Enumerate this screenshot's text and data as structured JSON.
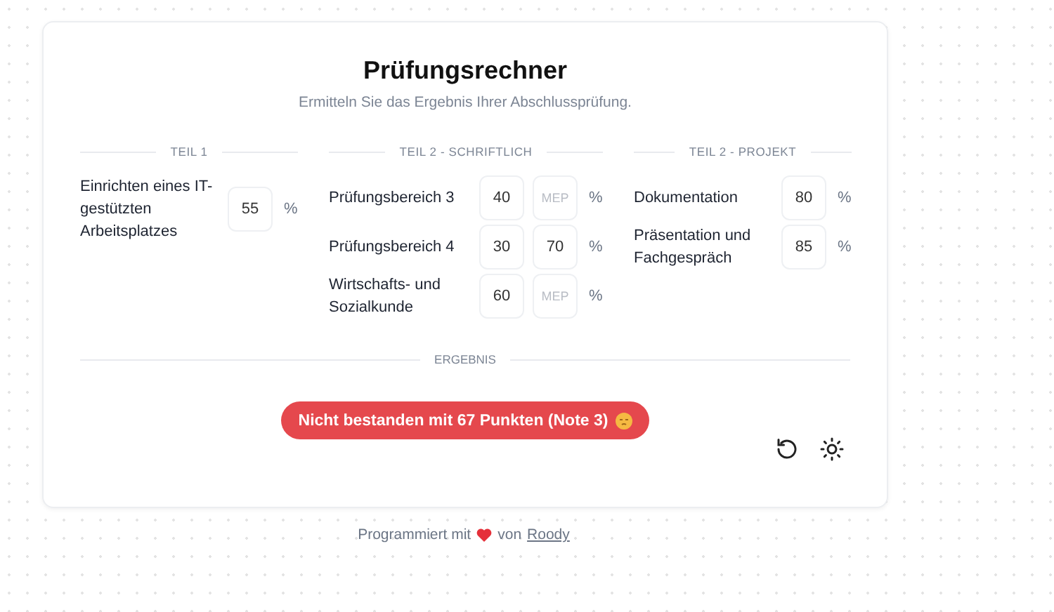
{
  "title": "Prüfungsrechner",
  "subtitle": "Ermitteln Sie das Ergebnis Ihrer Abschlussprüfung.",
  "sections": [
    {
      "heading": "TEIL 1",
      "fields": [
        {
          "label": "Einrichten eines IT-gestützten Arbeitsplatzes",
          "inputs": [
            {
              "value": "55"
            }
          ],
          "unit": "%"
        }
      ]
    },
    {
      "heading": "TEIL 2 - SCHRIFTLICH",
      "fields": [
        {
          "label": "Prüfungsbereich 3",
          "inputs": [
            {
              "value": "40"
            },
            {
              "placeholder": "MEP"
            }
          ],
          "unit": "%"
        },
        {
          "label": "Prüfungsbereich 4",
          "inputs": [
            {
              "value": "30"
            },
            {
              "value": "70"
            }
          ],
          "unit": "%"
        },
        {
          "label": "Wirtschafts- und Sozialkunde",
          "inputs": [
            {
              "value": "60"
            },
            {
              "placeholder": "MEP"
            }
          ],
          "unit": "%"
        }
      ]
    },
    {
      "heading": "TEIL 2 - PROJEKT",
      "fields": [
        {
          "label": "Dokumentation",
          "inputs": [
            {
              "value": "80"
            }
          ],
          "unit": "%"
        },
        {
          "label": "Präsentation und Fachgespräch",
          "inputs": [
            {
              "value": "85"
            }
          ],
          "unit": "%"
        }
      ]
    }
  ],
  "result_heading": "ERGEBNIS",
  "result": {
    "text": "Nicht bestanden mit 67 Punkten (Note 3)",
    "passed": false
  },
  "footer": {
    "text_before": "Programmiert mit",
    "text_after": "von",
    "link": "Roody"
  }
}
